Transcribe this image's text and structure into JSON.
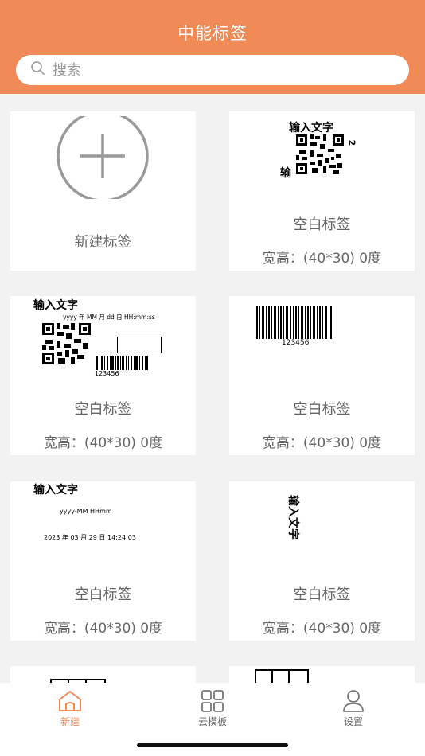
{
  "header": {
    "title": "中能标签"
  },
  "search": {
    "placeholder": "搜索"
  },
  "cards": [
    {
      "label": "新建标签"
    },
    {
      "label": "空白标签",
      "size": "宽高：(40*30) 0度",
      "preview_text": "输入文字",
      "preview_side": "输",
      "preview_corner": "2"
    },
    {
      "label": "空白标签",
      "size": "宽高：(40*30) 0度",
      "preview_text": "输入文字",
      "preview_date": "yyyy 年 MM 月 dd 日 HH:mm:ss",
      "barcode": "123456"
    },
    {
      "label": "空白标签",
      "size": "宽高：(40*30) 0度",
      "barcode": "123456"
    },
    {
      "label": "空白标签",
      "size": "宽高：(40*30) 0度",
      "preview_text": "输入文字",
      "preview_format": "yyyy-MM HHmm",
      "preview_datetime": "2023 年 03 月 29 日 14:24:03"
    },
    {
      "label": "空白标签",
      "size": "宽高：(40*30) 0度",
      "preview_text": "输入文字"
    }
  ],
  "tabs": [
    {
      "label": "新建",
      "icon": "home-icon",
      "active": true
    },
    {
      "label": "云模板",
      "icon": "grid-icon",
      "active": false
    },
    {
      "label": "设置",
      "icon": "user-icon",
      "active": false
    }
  ],
  "colors": {
    "accent": "#f08a56",
    "background": "#f2f2f2"
  }
}
